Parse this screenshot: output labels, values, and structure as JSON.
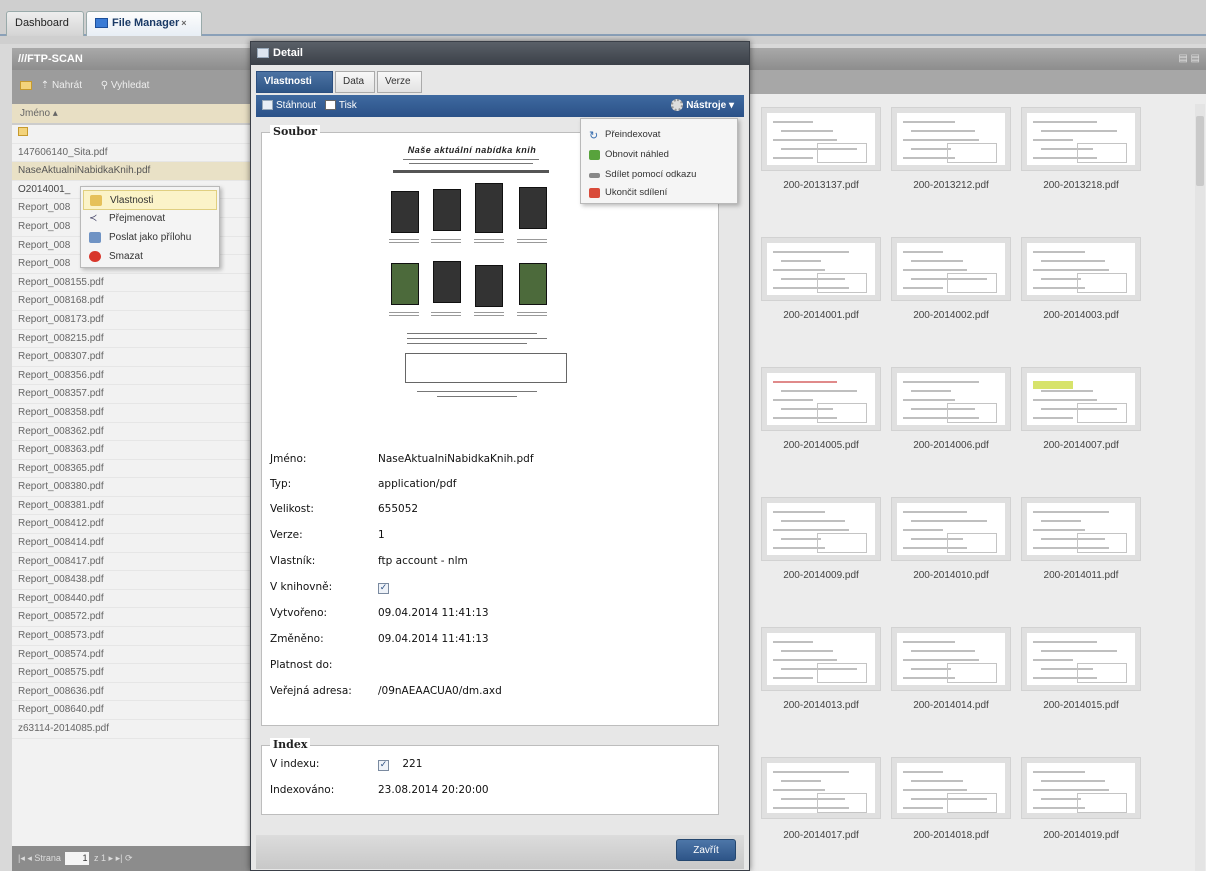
{
  "tabs": {
    "dashboard": "Dashboard",
    "file_manager": "File Manager",
    "close": "×"
  },
  "left_panel": {
    "title": "///FTP-SCAN",
    "toolbar": {
      "upload": "Nahrát",
      "search": "Vyhledat"
    },
    "column": "Jméno ▴",
    "files": [
      "147606140_Sita.pdf",
      "NaseAktualniNabidkaKnih.pdf",
      "O2014001_",
      "Report_008",
      "Report_008",
      "Report_008",
      "Report_008",
      "Report_008155.pdf",
      "Report_008168.pdf",
      "Report_008173.pdf",
      "Report_008215.pdf",
      "Report_008307.pdf",
      "Report_008356.pdf",
      "Report_008357.pdf",
      "Report_008358.pdf",
      "Report_008362.pdf",
      "Report_008363.pdf",
      "Report_008365.pdf",
      "Report_008380.pdf",
      "Report_008381.pdf",
      "Report_008412.pdf",
      "Report_008414.pdf",
      "Report_008417.pdf",
      "Report_008438.pdf",
      "Report_008440.pdf",
      "Report_008572.pdf",
      "Report_008573.pdf",
      "Report_008574.pdf",
      "Report_008575.pdf",
      "Report_008636.pdf",
      "Report_008640.pdf",
      "z63114-2014085.pdf"
    ],
    "pager": {
      "label": "Strana",
      "page": "1",
      "of": "z 1"
    }
  },
  "context_menu": {
    "items": [
      "Vlastnosti",
      "Přejmenovat",
      "Poslat jako přílohu",
      "Smazat"
    ]
  },
  "detail": {
    "title": "Detail",
    "tabs": [
      "Vlastnosti",
      "Data",
      "Verze"
    ],
    "toolbar": {
      "download": "Stáhnout",
      "print": "Tisk",
      "tools": "Nástroje ▾"
    },
    "file_section": "Soubor",
    "preview_title": "Naše aktuální nabídka knih",
    "props": [
      {
        "label": "Jméno:",
        "value": "NaseAktualniNabidkaKnih.pdf"
      },
      {
        "label": "Typ:",
        "value": "application/pdf"
      },
      {
        "label": "Velikost:",
        "value": "655052"
      },
      {
        "label": "Verze:",
        "value": "1"
      },
      {
        "label": "Vlastník:",
        "value": "ftp account - nlm"
      },
      {
        "label": "V knihovně:",
        "value": ""
      },
      {
        "label": "Vytvořeno:",
        "value": "09.04.2014 11:41:13"
      },
      {
        "label": "Změněno:",
        "value": "09.04.2014 11:41:13"
      },
      {
        "label": "Platnost do:",
        "value": ""
      },
      {
        "label": "Veřejná adresa:",
        "value": "/09nAEAACUA0/dm.axd"
      }
    ],
    "index_section": "Index",
    "index": {
      "in_index_label": "V indexu:",
      "in_index_value": "221",
      "indexed_label": "Indexováno:",
      "indexed_value": "23.08.2014 20:20:00"
    },
    "close_button": "Zavřít"
  },
  "tools_menu": {
    "items": [
      "Přeindexovat",
      "Obnovit náhled",
      "Sdílet pomocí odkazu",
      "Ukončit sdílení"
    ]
  },
  "thumbnails": [
    "200-2013137.pdf",
    "200-2013212.pdf",
    "200-2013218.pdf",
    "200-2014001.pdf",
    "200-2014002.pdf",
    "200-2014003.pdf",
    "200-2014005.pdf",
    "200-2014006.pdf",
    "200-2014007.pdf",
    "200-2014009.pdf",
    "200-2014010.pdf",
    "200-2014011.pdf",
    "200-2014013.pdf",
    "200-2014014.pdf",
    "200-2014015.pdf",
    "200-2014017.pdf",
    "200-2014018.pdf",
    "200-2014019.pdf"
  ]
}
